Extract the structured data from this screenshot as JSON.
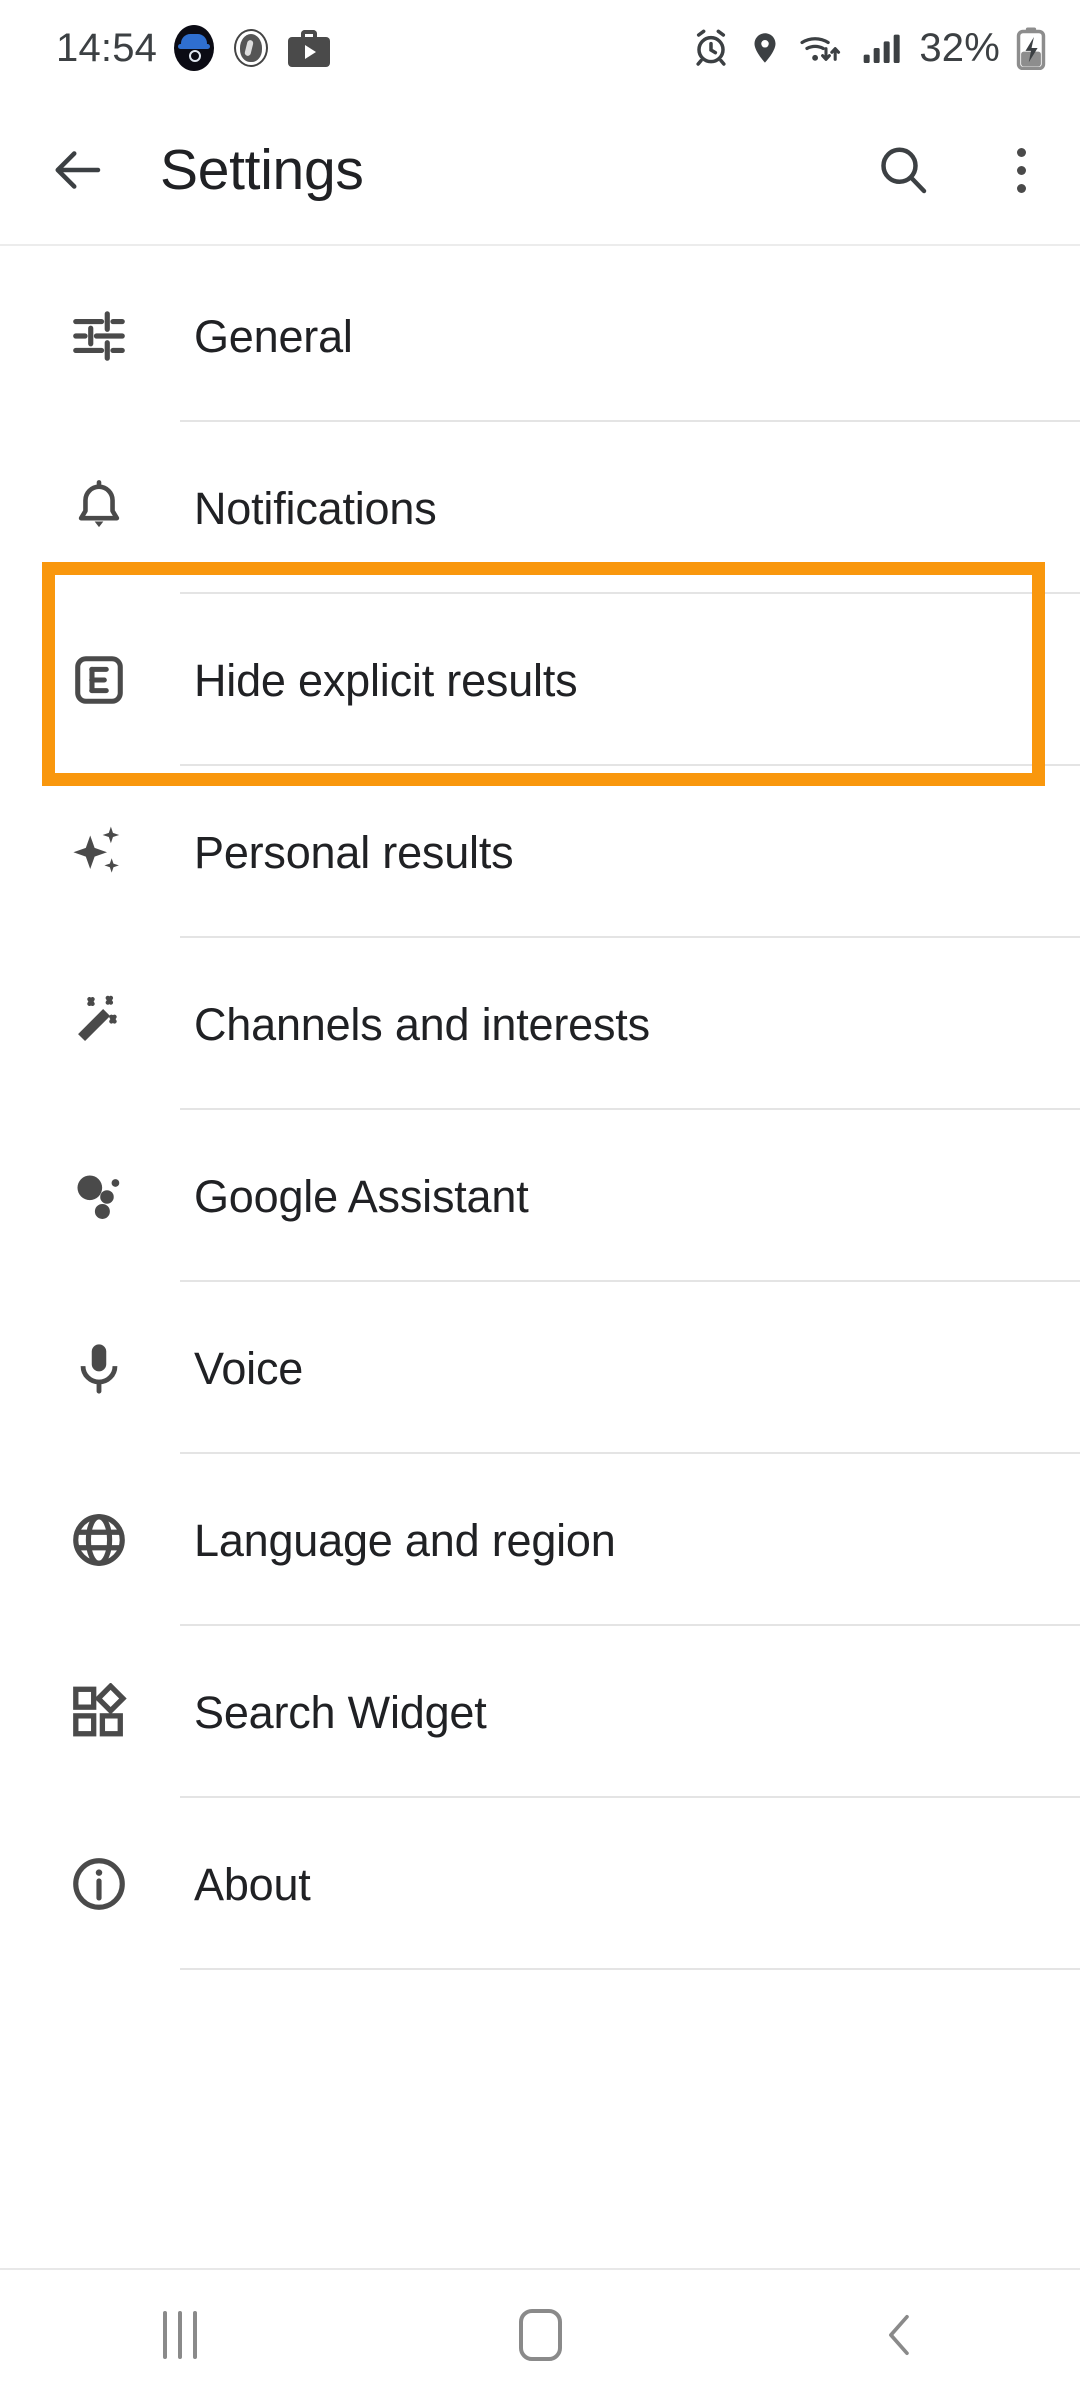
{
  "status_bar": {
    "time": "14:54",
    "battery_percent": "32%",
    "notification_icons": [
      "incognito-search-icon",
      "spy-circle-icon",
      "work-profile-play-icon"
    ],
    "system_icons": [
      "alarm-icon",
      "location-pin-icon",
      "wifi-transfer-icon",
      "signal-bars-icon",
      "battery-charging-icon"
    ],
    "text_color": "#3c4043"
  },
  "app_bar": {
    "back_label": "",
    "title": "Settings",
    "search_label": "",
    "overflow_label": ""
  },
  "list": {
    "items": [
      {
        "label": "General",
        "icon": "tune-sliders-icon"
      },
      {
        "label": "Notifications",
        "icon": "bell-icon"
      },
      {
        "label": "Hide explicit results",
        "icon": "explicit-e-icon"
      },
      {
        "label": "Personal results",
        "icon": "sparkles-icon"
      },
      {
        "label": "Channels and interests",
        "icon": "magic-wand-icon"
      },
      {
        "label": "Google Assistant",
        "icon": "assistant-dots-icon"
      },
      {
        "label": "Voice",
        "icon": "microphone-icon"
      },
      {
        "label": "Language and region",
        "icon": "globe-icon"
      },
      {
        "label": "Search Widget",
        "icon": "widgets-icon"
      },
      {
        "label": "About",
        "icon": "info-circle-icon"
      }
    ]
  },
  "highlight": {
    "target_label": "Hide explicit results",
    "color": "#F9970D"
  },
  "nav_bar": {
    "recents_label": "",
    "home_label": "",
    "back_label": ""
  }
}
